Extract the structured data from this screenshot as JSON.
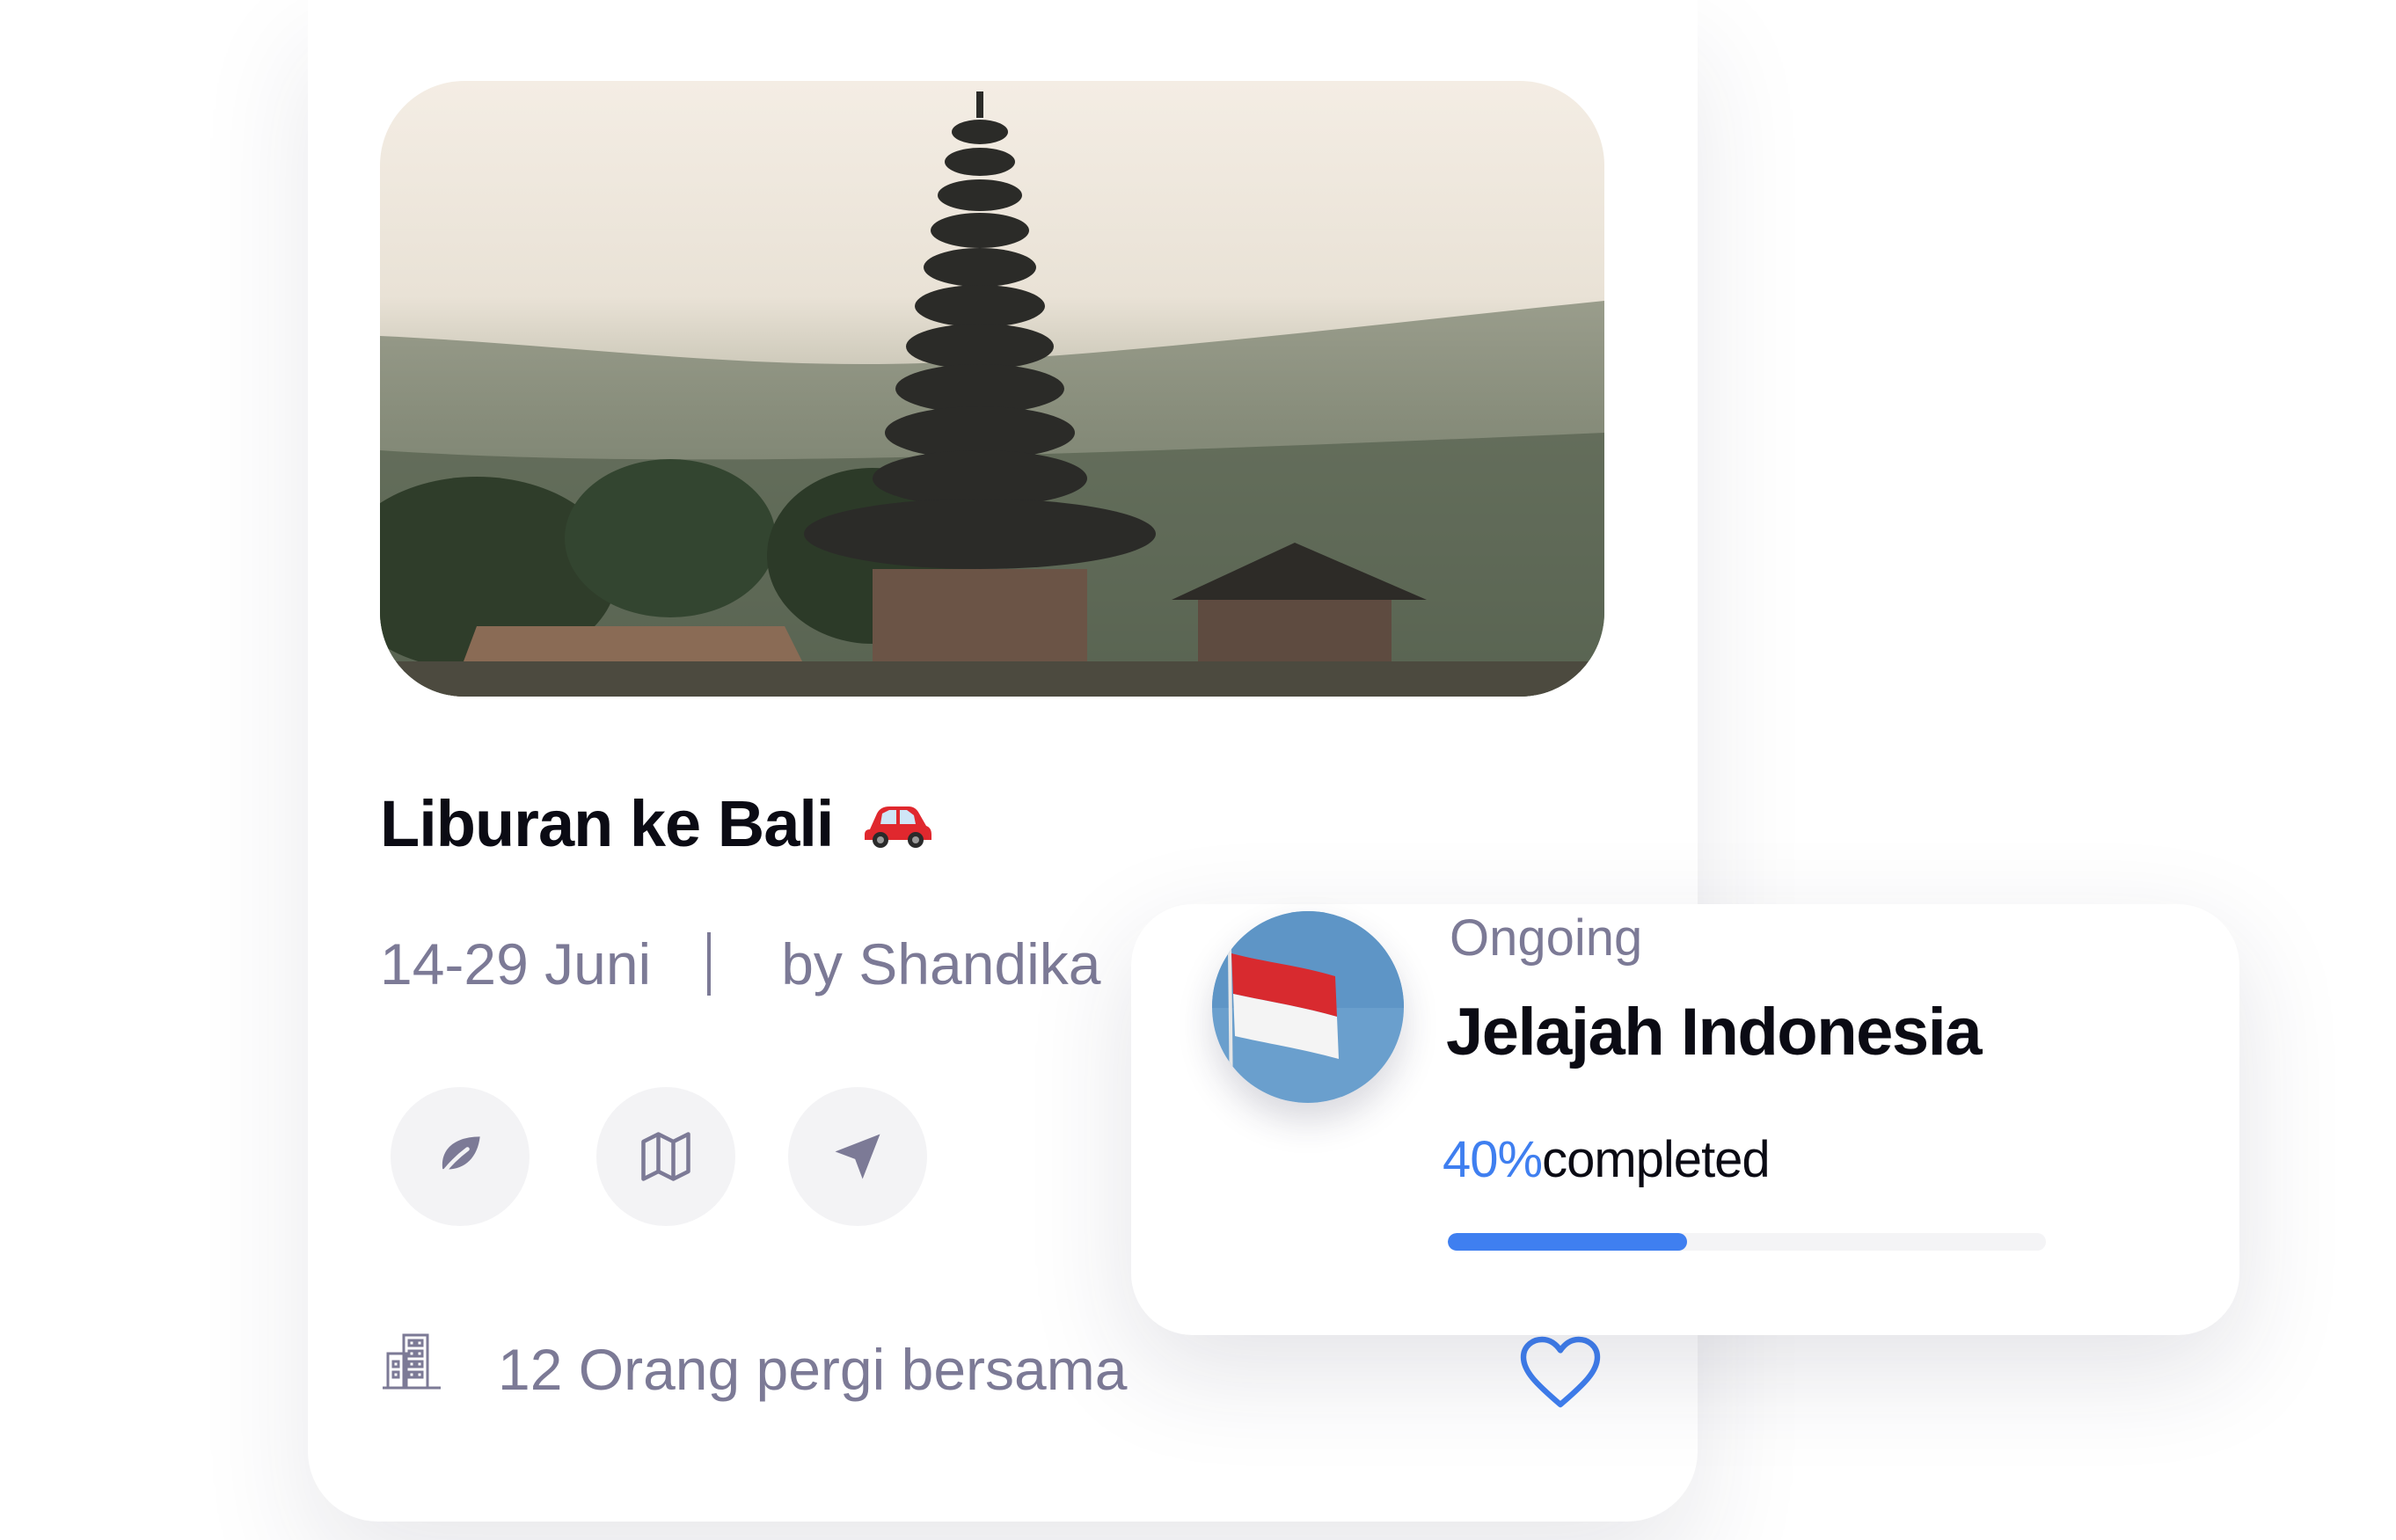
{
  "trip": {
    "title": "Liburan ke Bali",
    "title_emoji": "car-icon",
    "dates": "14-29 Juni",
    "author": "by Shandika",
    "people": "12 Orang pergi bersama",
    "photo": "bali-temple-photo"
  },
  "actions": [
    {
      "name": "leaf-icon"
    },
    {
      "name": "map-icon"
    },
    {
      "name": "send-icon"
    }
  ],
  "progress_card": {
    "status": "Ongoing",
    "title": "Jelajah Indonesia",
    "percent_label": "40%",
    "completed_label": "completed",
    "progress": 0.4,
    "avatar": "indonesia-flag"
  },
  "colors": {
    "accent": "#3f7ff0",
    "muted_text": "#7c7a96",
    "heading": "#0b0b14",
    "button_bg": "#f3f3f5"
  }
}
